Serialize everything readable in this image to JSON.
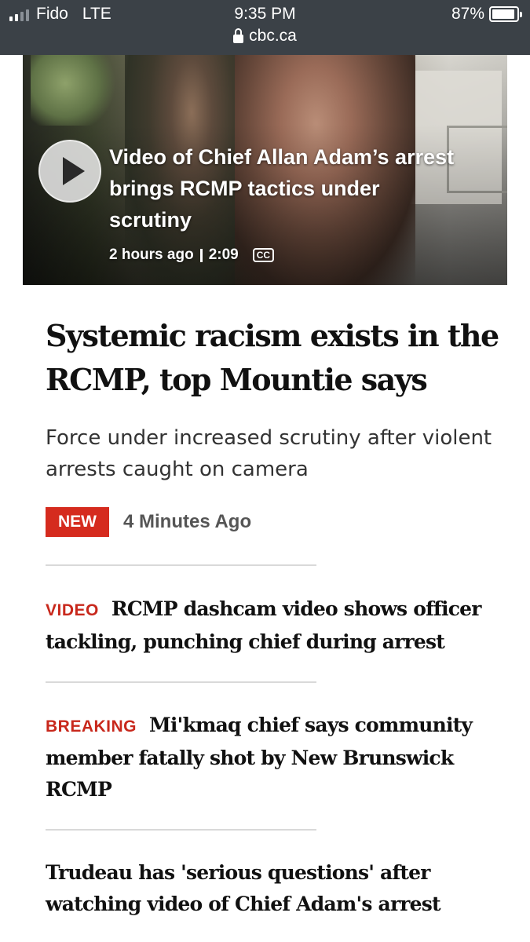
{
  "status_bar": {
    "carrier": "Fido",
    "network": "LTE",
    "time": "9:35 PM",
    "url": "cbc.ca",
    "battery": "87%",
    "battery_level": 0.87,
    "signal_bars": 2
  },
  "hero": {
    "title": "Video of Chief Allan Adam’s arrest brings RCMP tactics under scrutiny",
    "time": "2 hours ago",
    "duration": "2:09",
    "cc_label": "CC"
  },
  "main_story": {
    "headline": "Systemic racism exists in the RCMP, top Mountie says",
    "dek": "Force under increased scrutiny after violent arrests caught on camera",
    "badge": "NEW",
    "time": "4 Minutes Ago"
  },
  "related": [
    {
      "label": "VIDEO",
      "title": "RCMP dashcam video shows officer tackling, punching chief during arrest"
    },
    {
      "label": "BREAKING",
      "title": "Mi'kmaq chief says community member fatally shot by New Brunswick RCMP"
    },
    {
      "label": "",
      "title": "Trudeau has 'serious questions' after watching video of Chief Adam's arrest"
    }
  ],
  "colors": {
    "status_bar_bg": "#3b4147",
    "accent_red": "#d52b1e",
    "label_red": "#c8281c"
  }
}
